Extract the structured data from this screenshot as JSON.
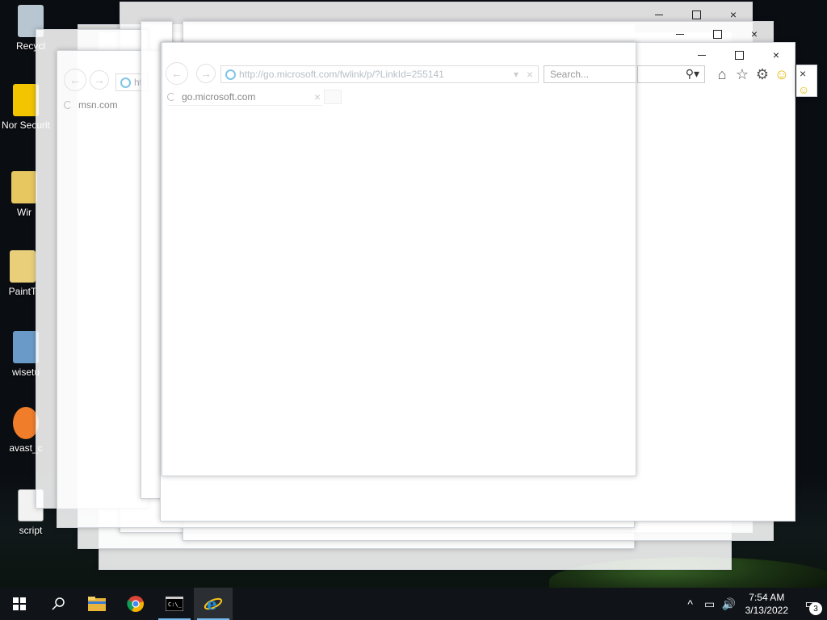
{
  "desktop": {
    "icons": [
      {
        "label": "Recycle Bin",
        "visible": "Recycl"
      },
      {
        "label": "Norton Security",
        "visible": "Nor Securit"
      },
      {
        "label": "Win",
        "visible": "Wir"
      },
      {
        "label": "PaintTool",
        "visible": "PaintT"
      },
      {
        "label": "wisetu",
        "visible": "wisetu"
      },
      {
        "label": "avast",
        "visible": "avast_c"
      },
      {
        "label": "script",
        "visible": "script"
      }
    ]
  },
  "browser_front": {
    "address_url": "http://go.microsoft.com/fwlink/p/?LinkId=255141",
    "search_placeholder": "Search...",
    "tab_title": "go.microsoft.com",
    "tab_close": "×"
  },
  "browser_back": {
    "tab_title": "msn.com",
    "address_prefix": "ht"
  },
  "taskbar": {
    "time": "7:54 AM",
    "date": "3/13/2022",
    "notification_count": "3",
    "apps": [
      "start",
      "search",
      "file-explorer",
      "chrome",
      "command-prompt",
      "internet-explorer"
    ]
  },
  "colors": {
    "taskbar_bg": "#101317",
    "active_indicator": "#76b9ed",
    "ie_blue": "#1f8fdb",
    "ie_gold": "#f6c419"
  }
}
